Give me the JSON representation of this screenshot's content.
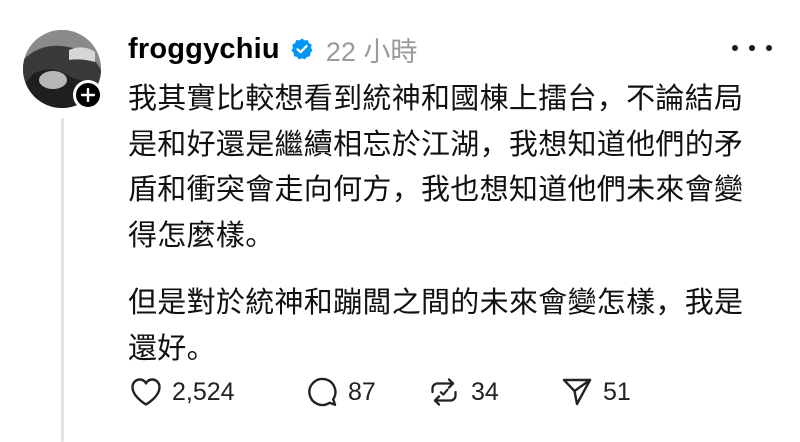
{
  "author": {
    "username": "froggychiu",
    "verified": true,
    "timestamp": "22 小時"
  },
  "post": {
    "paragraphs": [
      "我其實比較想看到統神和國棟上擂台，不論結局\n是和好還是繼續相忘於江湖，我想知道他們的矛\n盾和衝突會走向何方，我也想知道他們未來會變\n得怎麼樣。",
      "但是對於統神和蹦闆之間的未來會變怎樣，我是\n還好。"
    ]
  },
  "actions": {
    "likes": "2,524",
    "replies": "87",
    "reposts": "34",
    "shares": "51"
  },
  "colors": {
    "verified_badge": "#0095f6",
    "text": "#111111",
    "muted": "#9a9a9a",
    "thread_line": "#e3e3e3"
  },
  "icons": {
    "avatar": "profile-photo",
    "follow": "plus-icon",
    "verified": "verified-badge-icon",
    "more": "more-dots-icon",
    "like": "heart-icon",
    "reply": "comment-icon",
    "repost": "repost-icon",
    "share": "send-icon"
  }
}
